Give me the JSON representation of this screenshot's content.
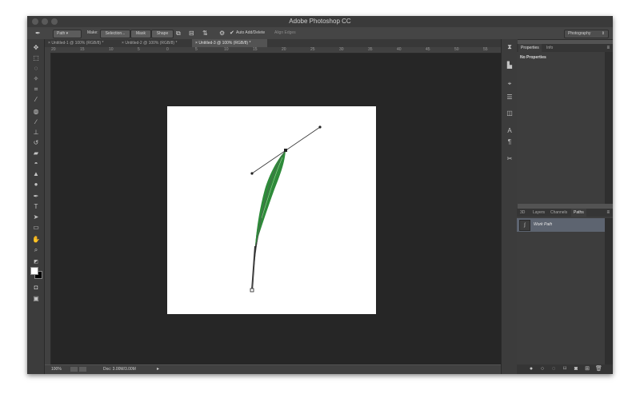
{
  "app": {
    "title": "Adobe Photoshop CC"
  },
  "options": {
    "tool_mode": "Path",
    "make_label": "Make:",
    "selection_btn": "Selection...",
    "mask_btn": "Mask",
    "shape_btn": "Shape",
    "auto_add": "Auto Add/Delete",
    "align_edges": "Align Edges",
    "workspace": "Photography"
  },
  "tabs": [
    {
      "label": "Untitled-1 @ 100% (RGB/8) *"
    },
    {
      "label": "Untitled-2 @ 100% (RGB/8) *"
    },
    {
      "label": "Untitled-3 @ 100% (RGB/8) *"
    }
  ],
  "ruler": {
    "labels": [
      "20",
      "15",
      "10",
      "5",
      "0",
      "5",
      "10",
      "15",
      "20",
      "25",
      "30",
      "35",
      "40",
      "45",
      "50",
      "55"
    ]
  },
  "status": {
    "zoom": "100%",
    "doc_info": "Doc: 3.00M/3.00M"
  },
  "properties_panel": {
    "tabs": [
      "Properties",
      "Info"
    ],
    "content": "No Properties"
  },
  "paths_panel": {
    "tabs": [
      "3D",
      "Layers",
      "Channels",
      "Paths"
    ],
    "items": [
      {
        "name": "Work Path"
      }
    ]
  },
  "colors": {
    "window_bg": "#535353",
    "canvas_bg": "#262626",
    "document": "#ffffff",
    "feather": "#2e8b3a",
    "selected_row": "#5d6470"
  }
}
